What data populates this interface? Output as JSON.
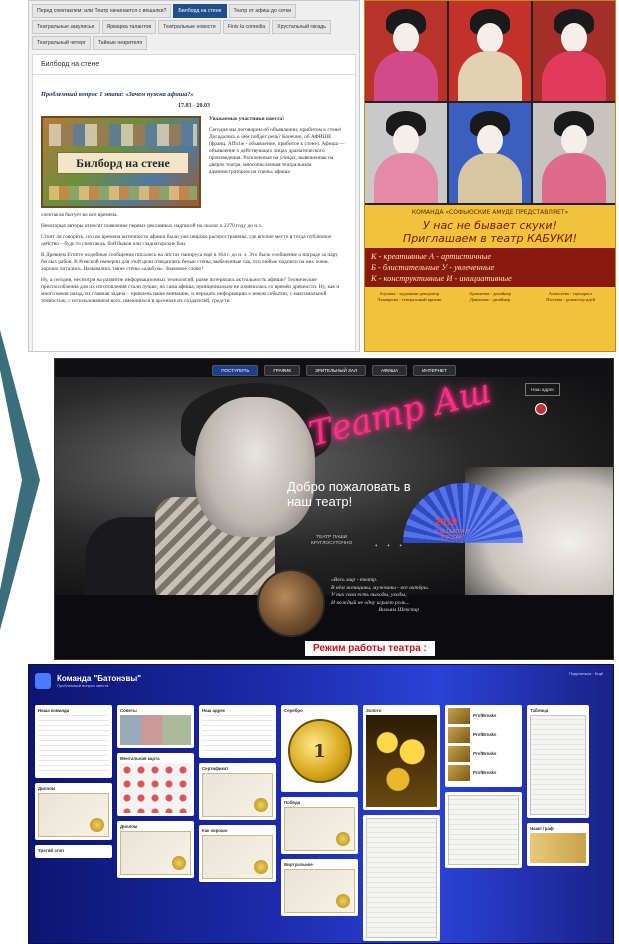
{
  "web_page": {
    "tabs": [
      {
        "label": "Перед спектаклем: или Театр начинается с вешалки?",
        "active": false
      },
      {
        "label": "Билборд на стене",
        "active": true
      },
      {
        "label": "Театр от афиш до сетки",
        "active": false
      },
      {
        "label": "Театральные закулисье",
        "active": false
      },
      {
        "label": "Ярмарка талантов",
        "active": false
      },
      {
        "label": "Театральные новости",
        "active": false
      },
      {
        "label": "Finis la comedia",
        "active": false
      },
      {
        "label": "Хрустальный гвоздь",
        "active": false
      },
      {
        "label": "Театральный четерг",
        "active": false
      },
      {
        "label": "Тайные незрителя",
        "active": false
      }
    ],
    "page_title": "Билборд на стене",
    "problem_question": "Проблемный вопрос 1 этапа: «Зачем нужна афиша?»",
    "dates": "17.03 - 20.03",
    "billboard_caption": "Билборд на стене",
    "greeting": "Уважаемые участники квеста!",
    "side_text": "Сегодня мы поговорим об объявлении, прибитом к стене! Догадались о чем пойдет речь? Конечно, об АФИШЕ (франц. Affiche - объявление, прибитое к стене). Афиша — объявление о действующих лицах драматического произведения. Расклеенная на улицах, вывешенная на дверях театра, многочисленная театральным администратором на сцены, афиша",
    "para_1": "спектакля бытует во все времена.",
    "para_2": "Некоторые авторы относят появление первых рекламных надписей на скалах к 2270 году до н.э.",
    "para_3": "Стоит ли говорить, что во времена античности афиши были уже широко распространены, где вполне место в тогда публичное действо – будь то спектакль, бой быков или гладиаторские бои.",
    "para_4": "В Древнем Египте подобные сообщения писались на листах папируса ещё в 164 г. до н. э. Это было сообщение о награде за пару беглых рабов. В Римской империи для этой цели отводились белые стены, выбеленные так, что любые надписи на них очень хорошо читались. Назывались такие стены «альбум». Знакомое слово?",
    "para_5": "Ну, а сегодня, несмотря на развитие информационных технологий, разве потерялась актуальность афиши? Технические приспособления для их изготовления стали лучше, но сама афиша, принципиально не изменилась со времён древности. Ну, как и много веков назад, их главная задача – привлечь наше внимание, и передать информацию о неком событии, с максимальной точностью, с использованием всех, имеющихся в арсенале их создателей, средств."
  },
  "poster": {
    "team_line": "КОМАНДА «СОФЬЮСКИЕ АМУДЕ ПРЕДСТАВЛЯЕТ»",
    "slogan_1": "У нас не бывает скуки!",
    "slogan_2": "Приглашаем в театр КАБУКИ!",
    "letters": [
      "К - креативные А - артистичные",
      "Б - блистательные У - увлеченные",
      "К - конструктивные И - инициативные"
    ],
    "roles": [
      "Азухова - художник-декоратор",
      "Аракчеева - дизайнер",
      "Алексеева - сценарист",
      "Эльвирова - театральный критик",
      "Данилова - дизайнер",
      "Полтава - режиссер идей"
    ]
  },
  "theatre_site": {
    "nav": [
      "ПОСТУПИТЬ",
      "ГРАФИК",
      "ЗРИТЕЛЬНЫЙ ЗАЛ",
      "АФИША",
      "ИНТЕРНЕТ"
    ],
    "neon_title": "Театр Аш",
    "welcome_1": "Добро пожаловать в",
    "welcome_2": "наш театр!",
    "year": "2019",
    "year_caption": "ГОД ТЕАТРА В РОССИИ",
    "small_button": "Наш адрес",
    "tagline_1": "ТЕАТР ПАШИ",
    "tagline_2": "КРУГЛОСУТОЧНО",
    "dots": "• • •",
    "quote": [
      "«Весь мир - театр.",
      "В нём женщины, мужчины - все актёры.",
      "У них свои есть выходы, уходы,",
      "И каждый не одну играет роль...",
      "Вильям Шекспир"
    ],
    "hours": "Режим работы театра :"
  },
  "board": {
    "title": "Команда \"Батонэвы\"",
    "subtitle": "Проблемный вопрос квеста",
    "top_right": "Поделиться · Ещё",
    "coin_label": "1",
    "columns": [
      {
        "cards": [
          {
            "title": "Наша команда"
          },
          {
            "title": "Диплом"
          },
          {
            "title": "Третий этап"
          }
        ]
      },
      {
        "cards": [
          {
            "title": "Советы"
          },
          {
            "title": "Ментальная карта"
          },
          {
            "title": "Диплом"
          }
        ]
      },
      {
        "cards": [
          {
            "title": "Наш адрес"
          },
          {
            "title": "Сертификат"
          },
          {
            "title": "Как хорошо"
          }
        ]
      },
      {
        "cards": [
          {
            "title": "Серебро"
          },
          {
            "title": "Победа"
          },
          {
            "title": "Виртуальное"
          }
        ]
      },
      {
        "cards": [
          {
            "title": "Золото"
          }
        ]
      },
      {
        "cards": [
          {
            "title": "ProfBreaks"
          },
          {
            "title": "ProfBreaks"
          },
          {
            "title": "ProfBreaks"
          },
          {
            "title": "ProfBreaks"
          }
        ]
      },
      {
        "cards": [
          {
            "title": "Таблица"
          },
          {
            "title": "Наше граф"
          }
        ]
      }
    ]
  }
}
